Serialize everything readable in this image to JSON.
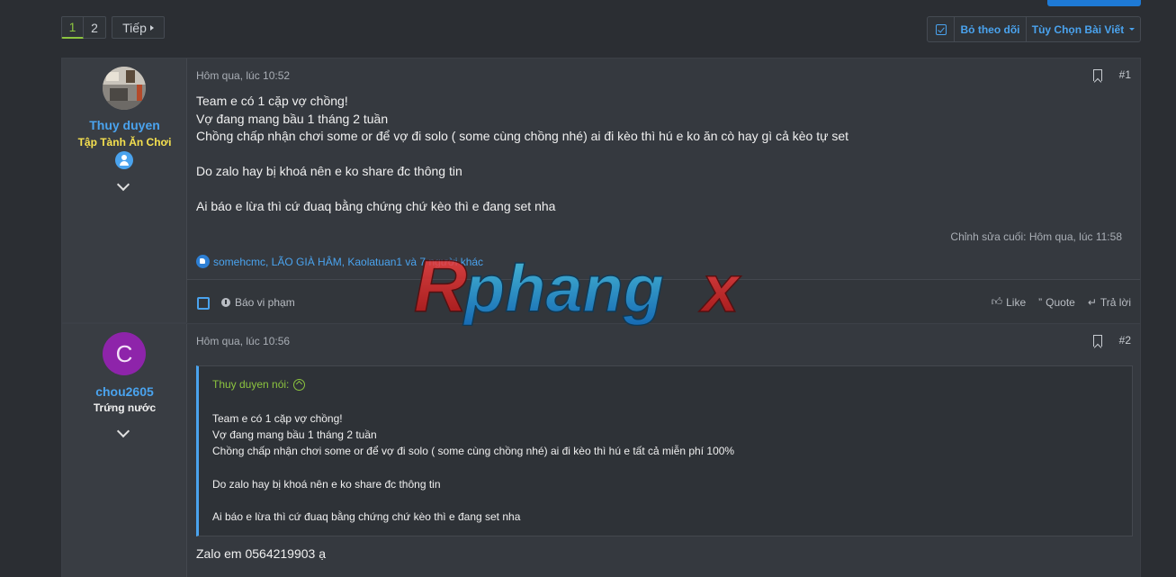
{
  "pagination": {
    "pages": [
      "1",
      "2"
    ],
    "current": "1",
    "next_label": "Tiếp"
  },
  "thread_actions": {
    "unfollow_label": "Bỏ theo dõi",
    "options_label": "Tùy Chọn Bài Viết"
  },
  "posts": [
    {
      "user": {
        "name": "Thuy duyen",
        "title": "Tập Tành Ăn Chơi",
        "title_color": "#f5e04f"
      },
      "date": "Hôm qua, lúc 10:52",
      "number": "#1",
      "lines": [
        "Team e có 1 cặp vợ chồng!",
        "Vợ đang mang bầu 1 tháng 2 tuần",
        "Chồng chấp nhận chơi some or để vợ đi solo ( some cùng chồng nhé) ai đi kèo thì hú e ko ăn cò hay gì cả kèo tự set",
        "",
        "Do zalo hay bị khoá nên e ko share đc thông tin",
        "",
        "Ai báo e lừa thì cứ đuaq bằng chứng chứ kèo thì e đang set nha"
      ],
      "edited": "Chỉnh sửa cuối: Hôm qua, lúc 11:58",
      "reactions": "somehcmc, LÃO GIÀ HÂM, Kaolatuan1 và 7 người khác",
      "footer": {
        "report": "Báo vi phạm",
        "like": "Like",
        "quote": "Quote",
        "reply": "Trả lời"
      }
    },
    {
      "user": {
        "name": "chou2605",
        "title": "Trứng nước",
        "avatar_letter": "C",
        "avatar_color": "#8e24aa"
      },
      "date": "Hôm qua, lúc 10:56",
      "number": "#2",
      "quote": {
        "author": "Thuy duyen nói:",
        "lines": [
          "Team e có 1 cặp vợ chồng!",
          "Vợ đang mang bầu 1 tháng 2 tuần",
          "Chồng chấp nhận chơi some or để vợ đi solo ( some cùng chồng nhé) ai đi kèo thì hú e tất cả miễn phí 100%",
          "",
          "Do zalo hay bị khoá nên e ko share đc thông tin",
          "",
          "Ai báo e lừa thì cứ đuaq bằng chứng chứ kèo thì e đang set nha"
        ]
      },
      "reply": "Zalo em 0564219903 ạ"
    }
  ],
  "watermark": "Rphangx",
  "colors": {
    "background": "#2b2e33",
    "link": "#4aa3ee",
    "accent_green": "#8cc43f"
  }
}
